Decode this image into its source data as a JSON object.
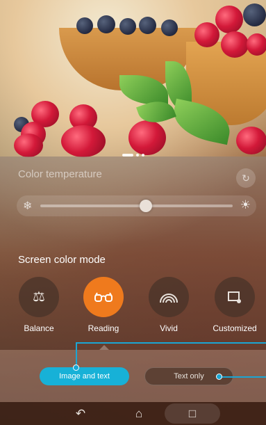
{
  "color_temperature": {
    "label": "Color temperature",
    "slider_value_pct": 55
  },
  "screen_color_mode": {
    "label": "Screen color mode",
    "modes": [
      {
        "label": "Balance",
        "icon": "balance-scale-icon",
        "active": false
      },
      {
        "label": "Reading",
        "icon": "glasses-icon",
        "active": true
      },
      {
        "label": "Vivid",
        "icon": "rainbow-icon",
        "active": false
      },
      {
        "label": "Customized",
        "icon": "customize-screen-icon",
        "active": false
      }
    ]
  },
  "reading_options": {
    "image_and_text": "Image and text",
    "text_only": "Text only",
    "selected": "image_and_text"
  },
  "accent_colors": {
    "active_mode": "#ef7a1d",
    "selected_option": "#17b1d7"
  }
}
